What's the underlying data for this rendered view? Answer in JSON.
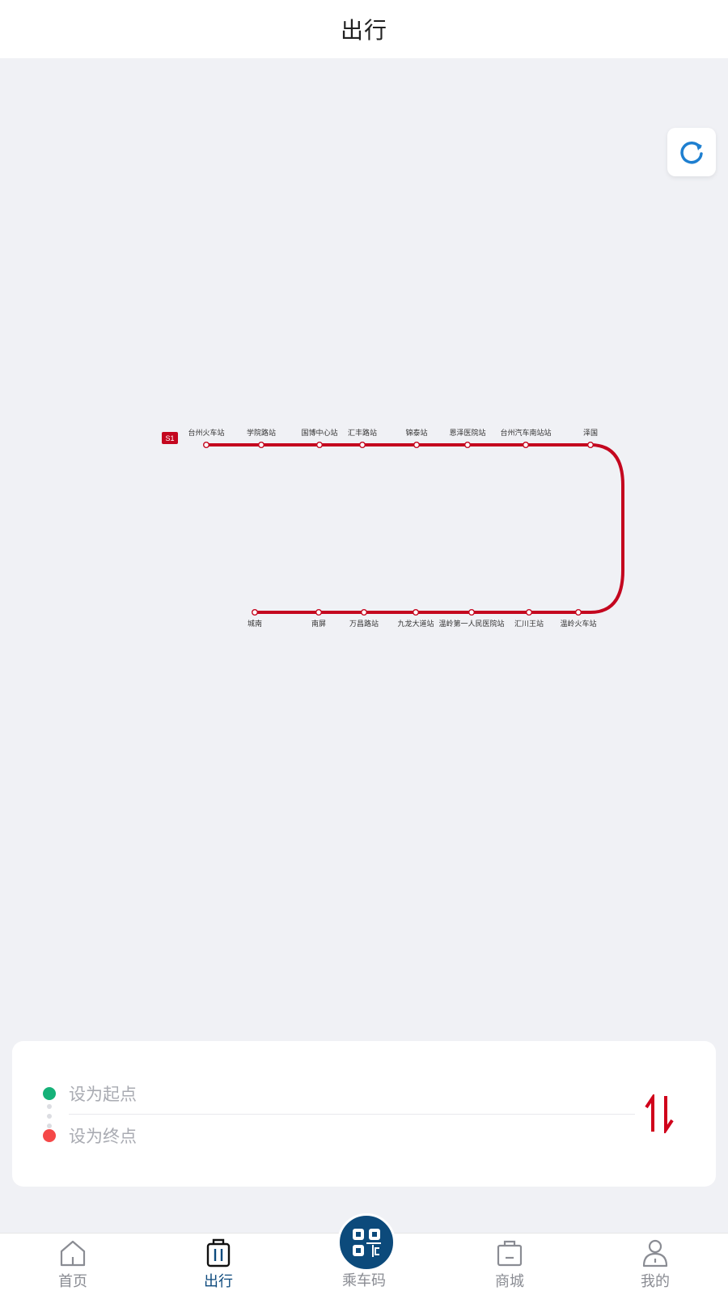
{
  "header": {
    "title": "出行"
  },
  "map": {
    "line_badge": "S1",
    "line_color": "#c4071f",
    "top_stations": [
      "台州火车站",
      "学院路站",
      "国博中心站",
      "汇丰路站",
      "锦泰站",
      "恩泽医院站",
      "台州汽车南站站",
      "泽国"
    ],
    "bottom_stations": [
      "城南",
      "南屏",
      "万昌路站",
      "九龙大道站",
      "温岭第一人民医院站",
      "汇川王站",
      "温岭火车站"
    ]
  },
  "route": {
    "start_placeholder": "设为起点",
    "end_placeholder": "设为终点",
    "start_color": "#15b178",
    "end_color": "#f54848"
  },
  "tabs": [
    {
      "label": "首页",
      "icon": "home-icon",
      "active": false
    },
    {
      "label": "出行",
      "icon": "luggage-icon",
      "active": true
    },
    {
      "label": "乘车码",
      "icon": "qr-code-icon",
      "active": false
    },
    {
      "label": "商城",
      "icon": "shopping-bag-icon",
      "active": false
    },
    {
      "label": "我的",
      "icon": "user-icon",
      "active": false
    }
  ],
  "colors": {
    "accent": "#0c4a7b",
    "background": "#f0f1f5",
    "refresh_icon": "#1e7fd0",
    "swap_icon": "#d0021b"
  }
}
